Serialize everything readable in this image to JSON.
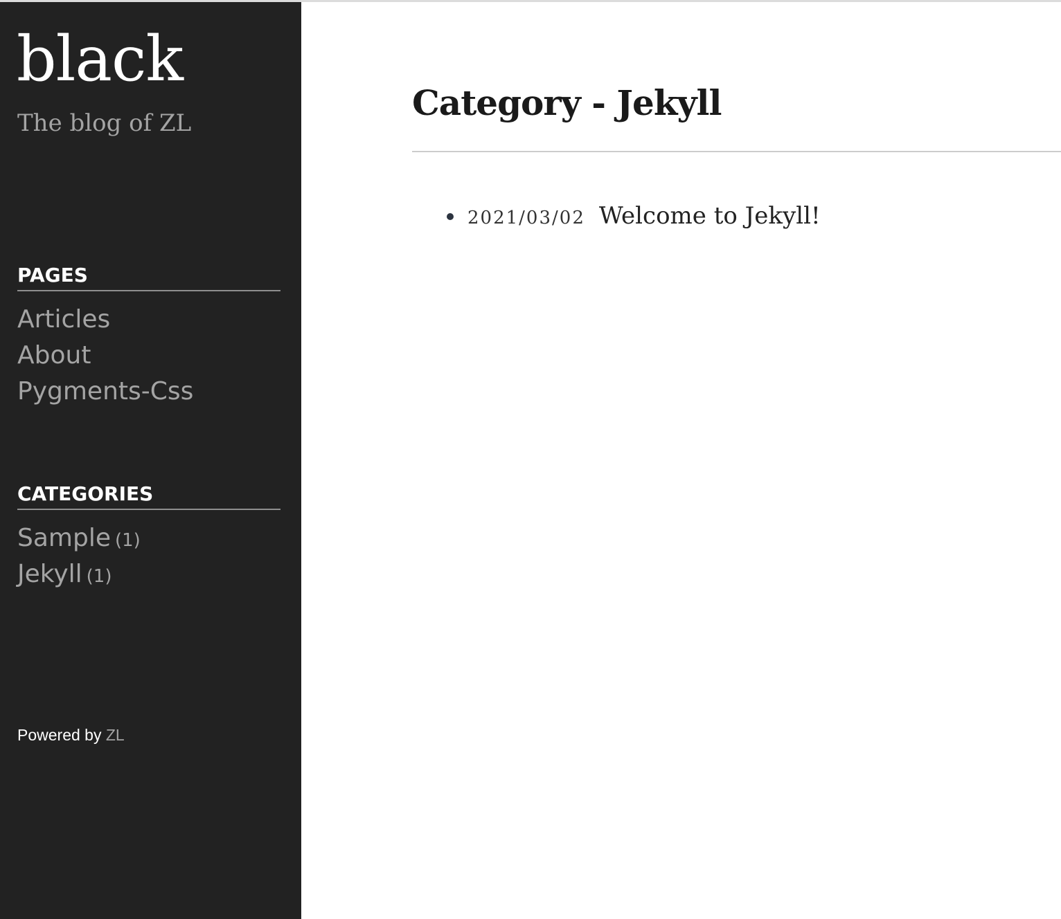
{
  "site": {
    "title": "black",
    "subtitle": "The blog of ZL"
  },
  "sidebar": {
    "pages": {
      "heading": "PAGES",
      "items": [
        {
          "label": "Articles"
        },
        {
          "label": "About"
        },
        {
          "label": "Pygments-Css"
        }
      ]
    },
    "categories": {
      "heading": "CATEGORIES",
      "items": [
        {
          "label": "Sample",
          "count": "(1)"
        },
        {
          "label": "Jekyll",
          "count": "(1)"
        }
      ]
    },
    "footer": {
      "prefix": "Powered by",
      "link": "ZL"
    }
  },
  "main": {
    "title": "Category - Jekyll",
    "posts": [
      {
        "date": "2021/03/02",
        "title": "Welcome to Jekyll!"
      }
    ]
  },
  "colors": {
    "sidebar_bg": "#222222",
    "muted_text": "#a4a4a4",
    "heading_text": "#ffffff"
  }
}
